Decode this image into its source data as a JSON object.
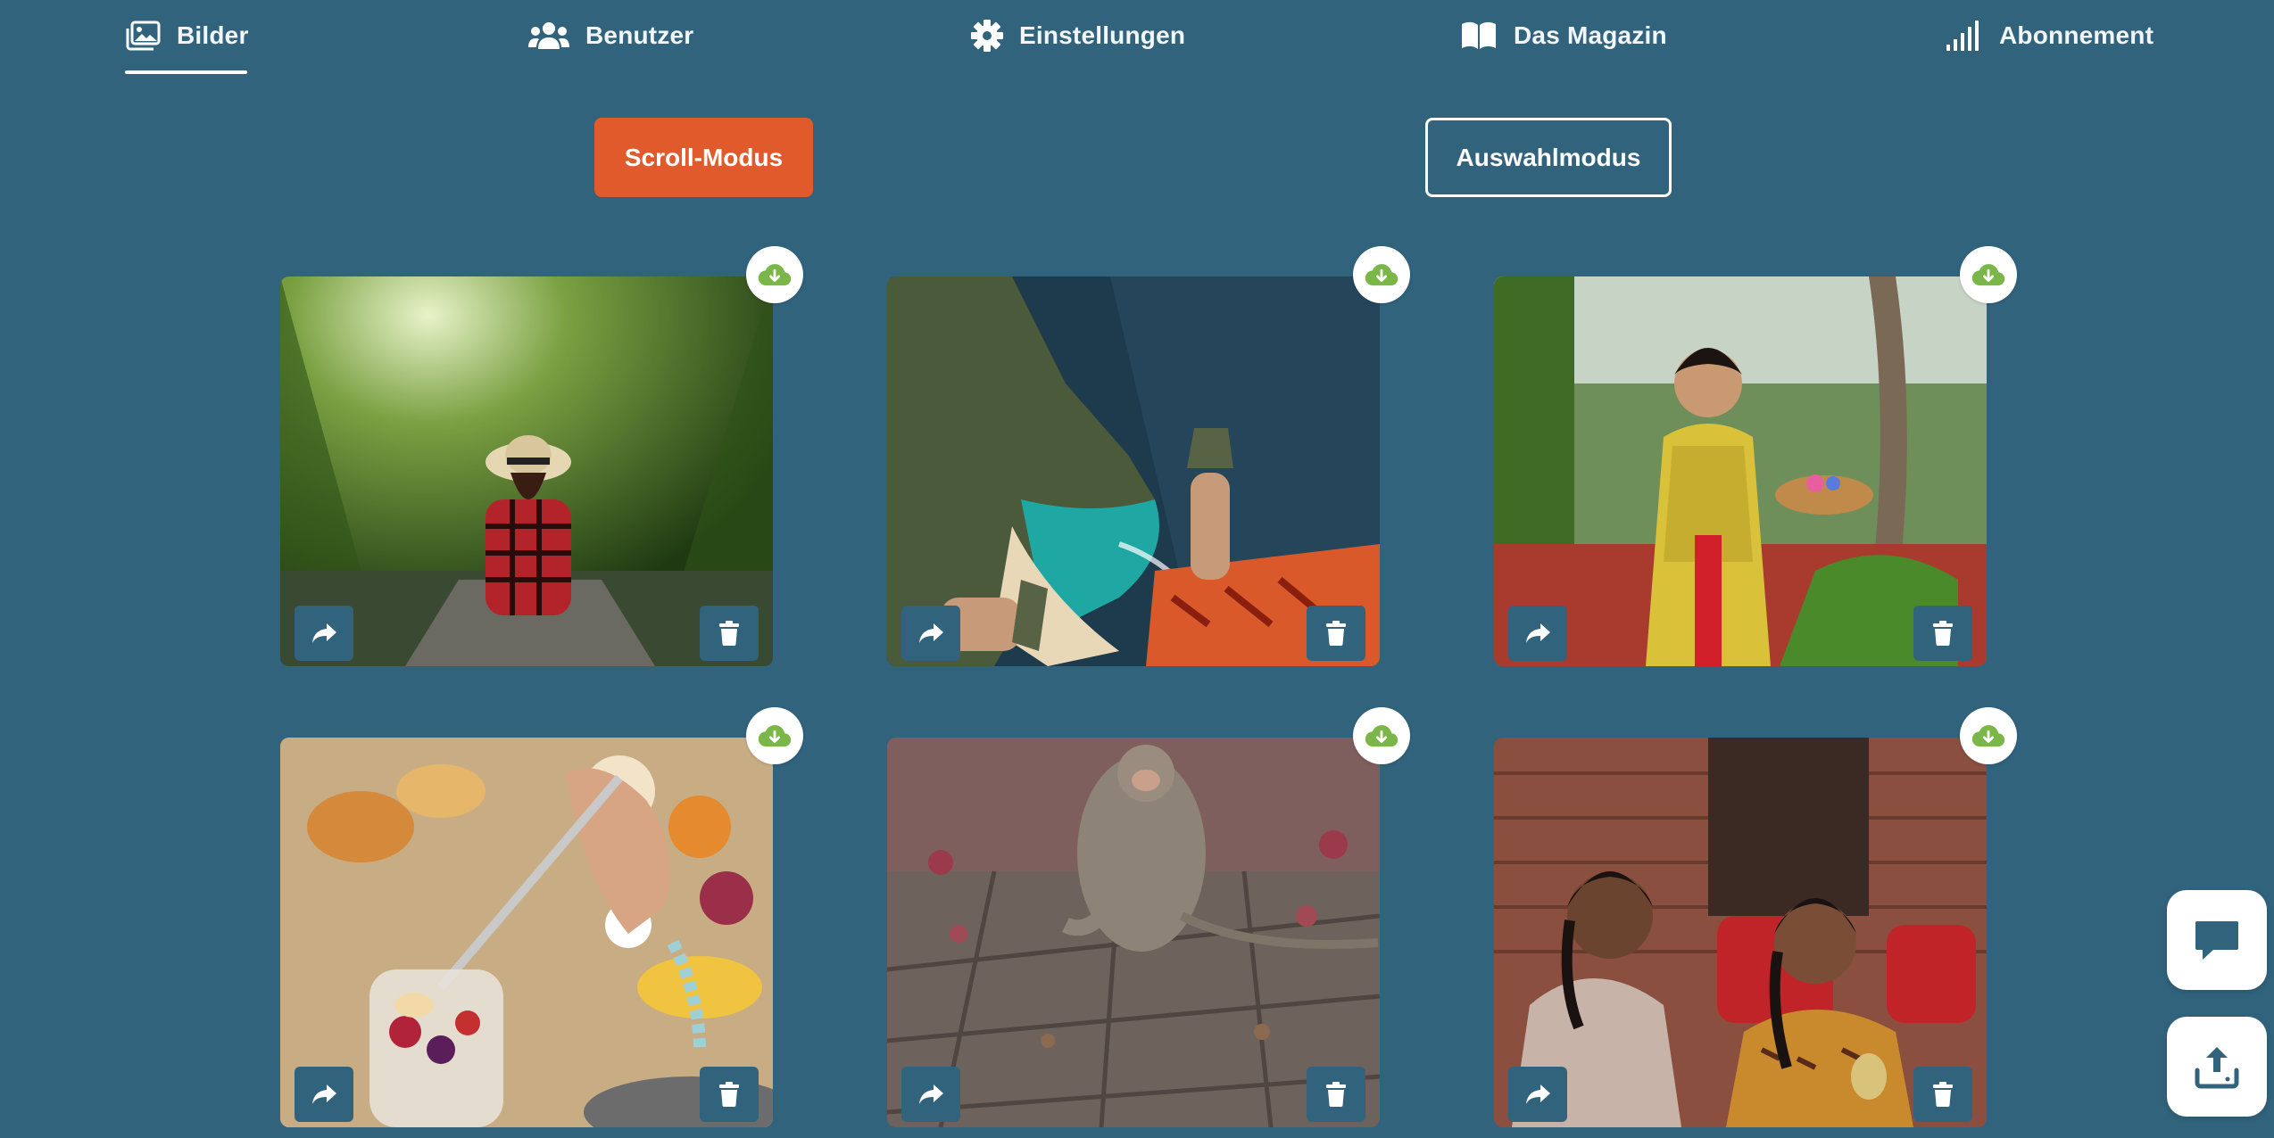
{
  "nav": {
    "items": [
      {
        "label": "Bilder",
        "icon": "images-icon",
        "active": true
      },
      {
        "label": "Benutzer",
        "icon": "users-icon",
        "active": false
      },
      {
        "label": "Einstellungen",
        "icon": "gear-icon",
        "active": false
      },
      {
        "label": "Das Magazin",
        "icon": "book-icon",
        "active": false
      },
      {
        "label": "Abonnement",
        "icon": "signal-bars-icon",
        "active": false
      }
    ]
  },
  "modes": {
    "scroll_label": "Scroll-Modus",
    "select_label": "Auswahlmodus"
  },
  "gallery": {
    "cards": [
      {
        "subject": "woman in boat under palm canopy",
        "download_icon": "cloud-download-icon",
        "share_icon": "share-icon",
        "delete_icon": "trash-icon"
      },
      {
        "subject": "feet over cliff and turquoise bay",
        "download_icon": "cloud-download-icon",
        "share_icon": "share-icon",
        "delete_icon": "trash-icon"
      },
      {
        "subject": "woman in yellow kebaya with offering basket",
        "download_icon": "cloud-download-icon",
        "share_icon": "share-icon",
        "delete_icon": "trash-icon"
      },
      {
        "subject": "breakfast spread with fruit jar",
        "download_icon": "cloud-download-icon",
        "share_icon": "share-icon",
        "delete_icon": "trash-icon"
      },
      {
        "subject": "monkey sitting on stone pavement",
        "download_icon": "cloud-download-icon",
        "share_icon": "share-icon",
        "delete_icon": "trash-icon"
      },
      {
        "subject": "two girls at temple wall",
        "download_icon": "cloud-download-icon",
        "share_icon": "share-icon",
        "delete_icon": "trash-icon"
      }
    ]
  },
  "side_actions": {
    "chat_icon": "chat-bubble-icon",
    "upload_icon": "upload-icon"
  },
  "colors": {
    "background": "#31637d",
    "accent": "#e15a2b",
    "download_green": "#7ab648"
  }
}
